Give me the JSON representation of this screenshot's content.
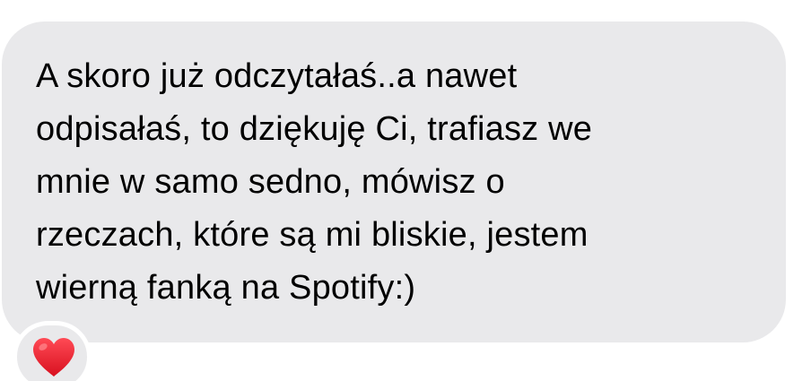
{
  "message": {
    "lines": [
      "A skoro już odczytałaś..a nawet",
      "odpisałaś, to dziękuję Ci, trafiasz we",
      "mnie w samo sedno, mówisz o",
      "rzeczach, które są mi bliskie, jestem",
      "wierną fanką na Spotify:)"
    ],
    "bubble_color": "#e9e9eb",
    "text_color": "#000000"
  },
  "reaction": {
    "icon": "red-heart-icon",
    "color": "#e0182d"
  }
}
